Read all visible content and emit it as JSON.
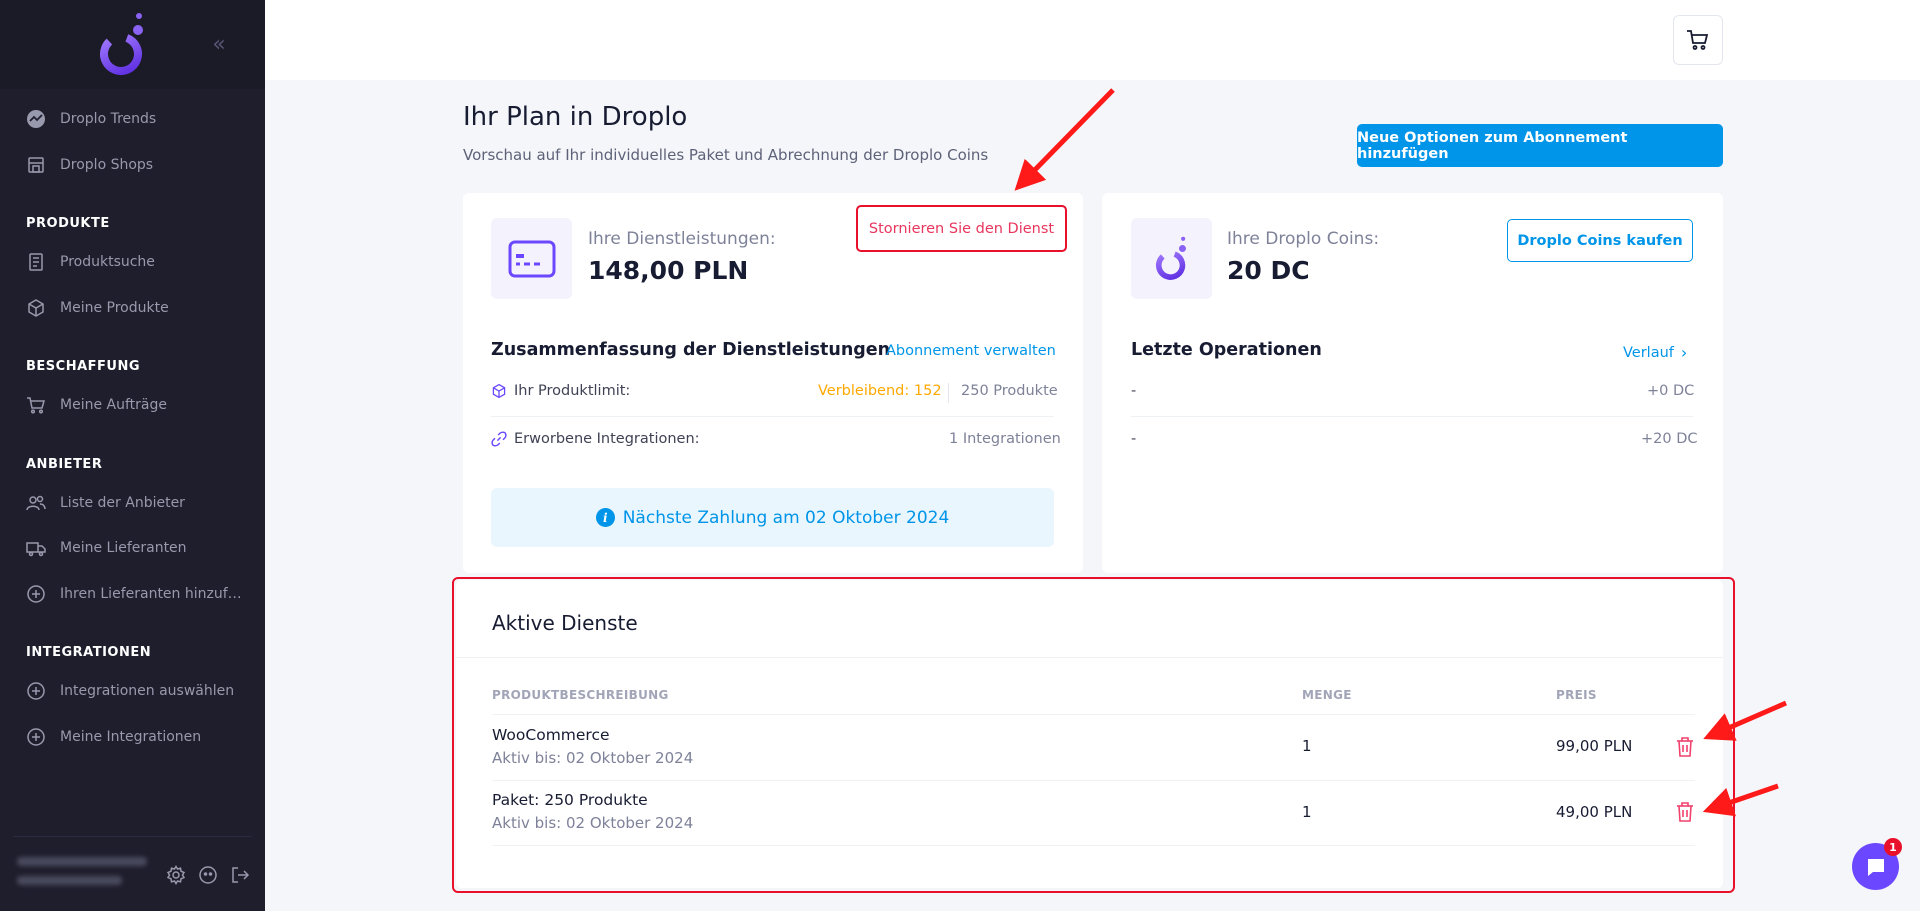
{
  "sidebar": {
    "items": [
      {
        "label": "Droplo Trends",
        "icon": "trends-icon"
      },
      {
        "label": "Droplo Shops",
        "icon": "shop-icon"
      },
      {
        "label": "Produktsuche",
        "icon": "catalog-icon"
      },
      {
        "label": "Meine Produkte",
        "icon": "box-icon"
      },
      {
        "label": "Meine Aufträge",
        "icon": "cart-icon"
      },
      {
        "label": "Liste der Anbieter",
        "icon": "users-icon"
      },
      {
        "label": "Meine Lieferanten",
        "icon": "truck-icon"
      },
      {
        "label": "Ihren Lieferanten hinzufügen",
        "icon": "plus-circle-icon"
      },
      {
        "label": "Integrationen auswählen",
        "icon": "plus-circle-icon"
      },
      {
        "label": "Meine Integrationen",
        "icon": "plus-circle-icon"
      }
    ],
    "sections": [
      "PRODUKTE",
      "BESCHAFFUNG",
      "ANBIETER",
      "INTEGRATIONEN"
    ]
  },
  "header": {
    "title": "Ihr Plan in Droplo",
    "subtitle": "Vorschau auf Ihr individuelles Paket und Abrechnung der Droplo Coins",
    "add_options_label": "Neue Optionen zum Abonnement hinzufügen"
  },
  "services_card": {
    "label": "Ihre Dienstleistungen:",
    "value": "148,00 PLN",
    "cancel_label": "Stornieren Sie den Dienst",
    "summary_title": "Zusammenfassung der Dienstleistungen",
    "manage_link": "Abonnement verwalten",
    "product_limit_label": "Ihr Produktlimit:",
    "remaining": "Verbleibend: 152",
    "product_limit_value": "250 Produkte",
    "integrations_label": "Erworbene Integrationen:",
    "integrations_value": "1 Integrationen",
    "next_payment": "Nächste Zahlung am 02 Oktober 2024"
  },
  "coins_card": {
    "label": "Ihre Droplo Coins:",
    "value": "20 DC",
    "buy_label": "Droplo Coins kaufen",
    "ops_title": "Letzte Operationen",
    "history_link": "Verlauf",
    "operations": [
      {
        "name": "-",
        "amount": "+0 DC"
      },
      {
        "name": "-",
        "amount": "+20 DC"
      }
    ]
  },
  "active_services": {
    "title": "Aktive Dienste",
    "columns": [
      "PRODUKTBESCHREIBUNG",
      "MENGE",
      "PREIS"
    ],
    "rows": [
      {
        "name": "WooCommerce",
        "active_until": "Aktiv bis: 02 Oktober 2024",
        "qty": "1",
        "price": "99,00 PLN"
      },
      {
        "name": "Paket: 250 Produkte",
        "active_until": "Aktiv bis: 02 Oktober 2024",
        "qty": "1",
        "price": "49,00 PLN"
      }
    ]
  },
  "chat": {
    "badge": "1"
  },
  "colors": {
    "sidebar": "#1e1e2d",
    "primary": "#0095e8",
    "danger": "#e8102a",
    "warning": "#ffc700",
    "brand_purple": "#6b48ff"
  }
}
